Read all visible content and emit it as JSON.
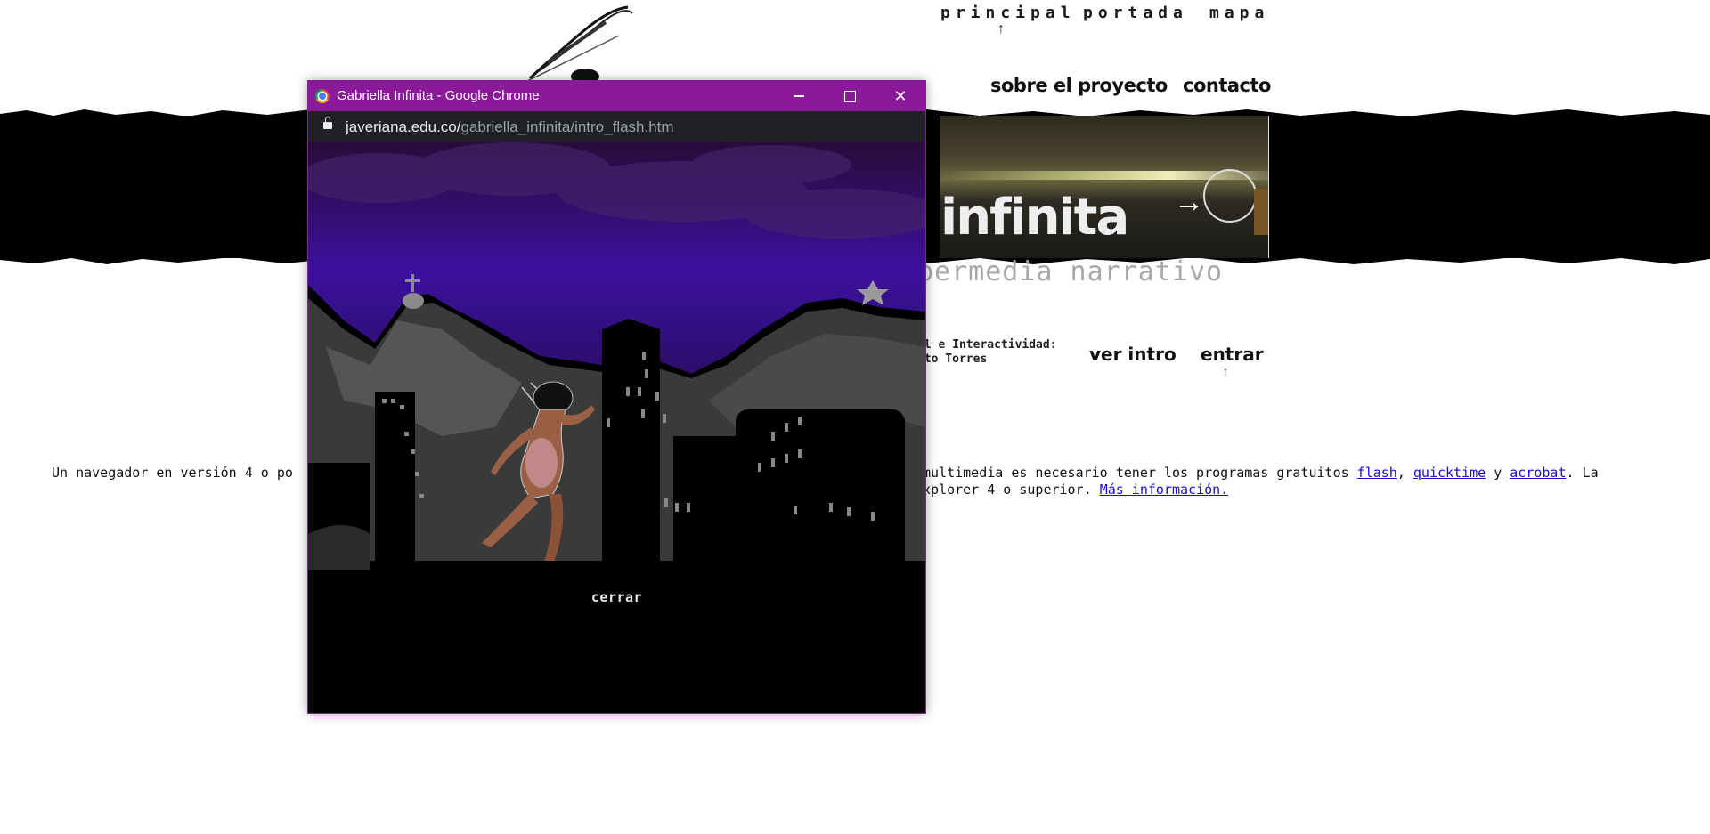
{
  "background_page": {
    "nav_top": {
      "principal": "principal",
      "portada": "portada",
      "mapa": "mapa",
      "arrow": "↑"
    },
    "nav_mid": {
      "sobre_el_proyecto": "sobre el proyecto",
      "contacto": "contacto"
    },
    "logo": {
      "word": "infinita"
    },
    "subtitle": "permedia narrativo",
    "credits": {
      "line1": "al e Interactividad:",
      "line2": "rto Torres"
    },
    "nav_low": {
      "ver_intro": "ver intro",
      "entrar": "entrar",
      "arrow": "↑"
    },
    "info": {
      "line1_start": "Un navegador en versión 4 o po",
      "line1_mid": "multimedia es necesario tener los programas gratuitos ",
      "flash": "flash",
      "sep1": ", ",
      "quicktime": "quicktime",
      "sep2": " y ",
      "acrobat": "acrobat",
      "line1_end": ". La",
      "line2_start": "xplorer 4 o superior. ",
      "mas_informacion": "Más información."
    }
  },
  "popup": {
    "title": "Gabriella Infinita - Google Chrome",
    "url_host": "javeriana.edu.co/",
    "url_path": "gabriella_infinita/intro_flash.htm",
    "close_link": "cerrar"
  },
  "icons": {
    "window": "chrome-icon",
    "lock": "lock-icon",
    "minimize": "minimize-icon",
    "maximize": "maximize-icon",
    "close": "close-icon",
    "window_close_glyph": "✕"
  },
  "colors": {
    "titlebar": "#8a1a9a",
    "addressbar": "#202124",
    "sky_top": "#2a0b3a",
    "sky_bottom": "#3b119e",
    "link": "#1a0dcc"
  }
}
